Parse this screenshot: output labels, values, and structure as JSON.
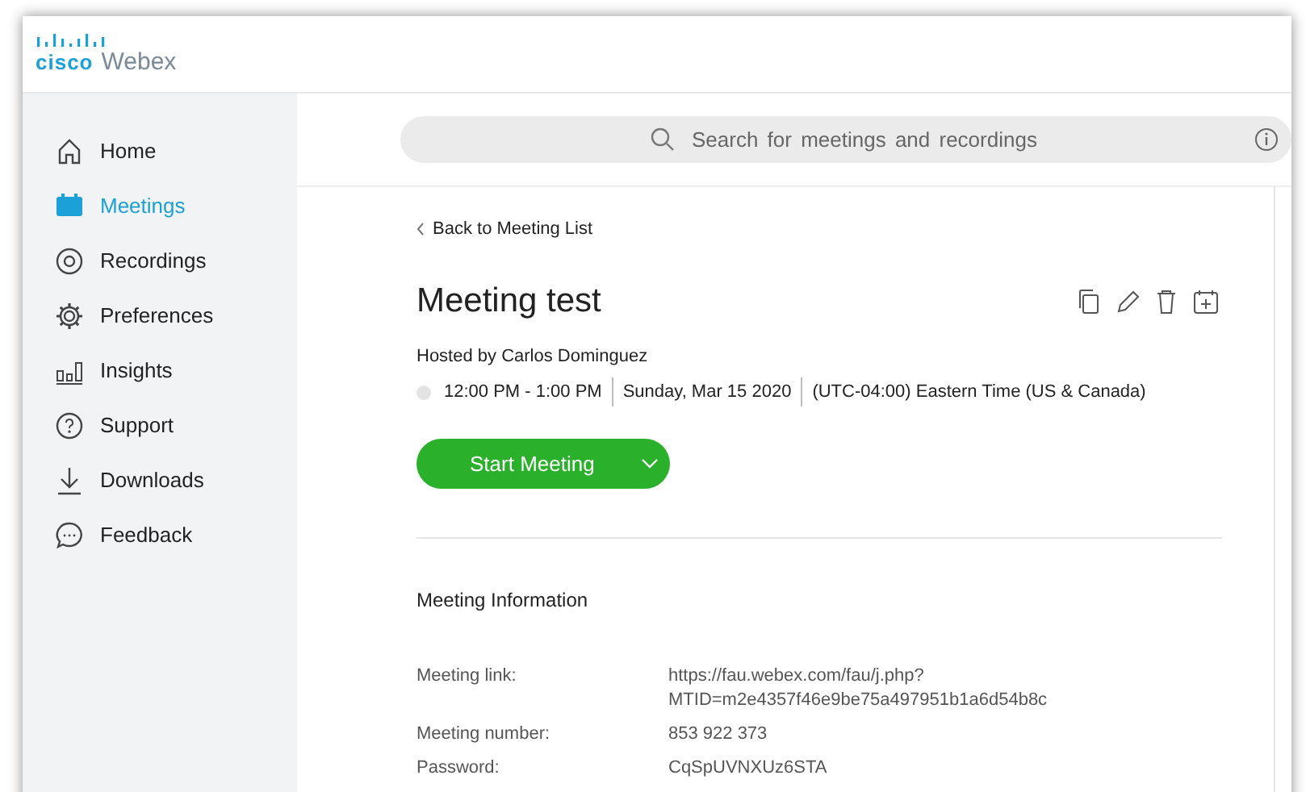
{
  "header": {
    "logo_brand": "cisco",
    "logo_product": "Webex"
  },
  "sidebar": {
    "items": [
      {
        "label": "Home",
        "selected": false
      },
      {
        "label": "Meetings",
        "selected": true
      },
      {
        "label": "Recordings",
        "selected": false
      },
      {
        "label": "Preferences",
        "selected": false
      },
      {
        "label": "Insights",
        "selected": false
      },
      {
        "label": "Support",
        "selected": false
      },
      {
        "label": "Downloads",
        "selected": false
      },
      {
        "label": "Feedback",
        "selected": false
      }
    ]
  },
  "search": {
    "placeholder": "Search for meetings and recordings"
  },
  "back_link": "Back to Meeting List",
  "meeting": {
    "title": "Meeting test",
    "host": "Hosted by Carlos Dominguez",
    "time": "12:00 PM - 1:00 PM",
    "date": "Sunday, Mar 15 2020",
    "timezone": "(UTC-04:00) Eastern Time (US & Canada)",
    "start_button": "Start Meeting"
  },
  "info": {
    "heading": "Meeting Information",
    "rows": [
      {
        "label": "Meeting link:",
        "value": [
          "https://fau.webex.com/fau/j.php?",
          "MTID=m2e4357f46e9be75a497951b1a6d54b8c"
        ]
      },
      {
        "label": "Meeting number:",
        "value": [
          "853 922 373"
        ]
      },
      {
        "label": "Password:",
        "value": [
          "CqSpUVNXUz6STA"
        ]
      }
    ]
  }
}
